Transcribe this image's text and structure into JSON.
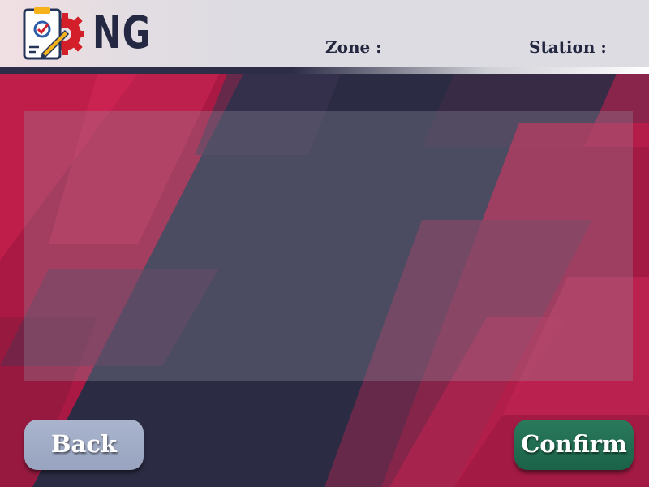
{
  "header": {
    "app_name": "NG",
    "zone_label": "Zone :",
    "station_label": "Station :"
  },
  "footer": {
    "back_label": "Back",
    "confirm_label": "Confirm"
  },
  "icons": {
    "logo": "checklist-gear-icon"
  },
  "colors": {
    "background_dark": "#2b2b44",
    "background_red": "#b11843",
    "back_button": "#a4afc9",
    "confirm_button": "#22705a",
    "header_text": "#252842"
  }
}
